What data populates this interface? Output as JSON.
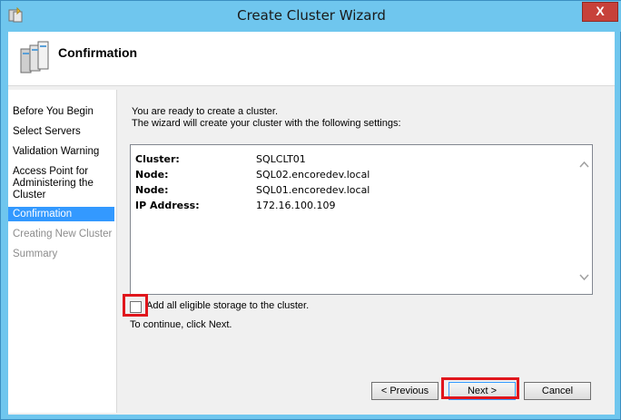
{
  "window": {
    "title": "Create Cluster Wizard",
    "close_glyph": "X",
    "accent_color": "#6fc6ee",
    "close_color": "#c7413a"
  },
  "header": {
    "title": "Confirmation",
    "icon": "server-cluster-icon"
  },
  "nav": {
    "items": [
      {
        "label": "Before You Begin",
        "state": "normal"
      },
      {
        "label": "Select Servers",
        "state": "normal"
      },
      {
        "label": "Validation Warning",
        "state": "normal"
      },
      {
        "label": "Access Point for Administering the Cluster",
        "state": "normal"
      },
      {
        "label": "Confirmation",
        "state": "active"
      },
      {
        "label": "Creating New Cluster",
        "state": "disabled"
      },
      {
        "label": "Summary",
        "state": "disabled"
      }
    ]
  },
  "content": {
    "intro_line1": "You are ready to create a cluster.",
    "intro_line2": "The wizard will create your cluster with the following settings:",
    "settings": [
      {
        "key": "Cluster:",
        "value": "SQLCLT01"
      },
      {
        "key": "Node:",
        "value": "SQL02.encoredev.local"
      },
      {
        "key": "Node:",
        "value": "SQL01.encoredev.local"
      },
      {
        "key": "IP Address:",
        "value": "172.16.100.109"
      }
    ],
    "checkbox_label": "Add all eligible storage to the cluster.",
    "checkbox_checked": false,
    "continue_text": "To continue, click Next."
  },
  "buttons": {
    "previous": "< Previous",
    "next": "Next >",
    "cancel": "Cancel"
  },
  "highlight_color": "#e0161c"
}
